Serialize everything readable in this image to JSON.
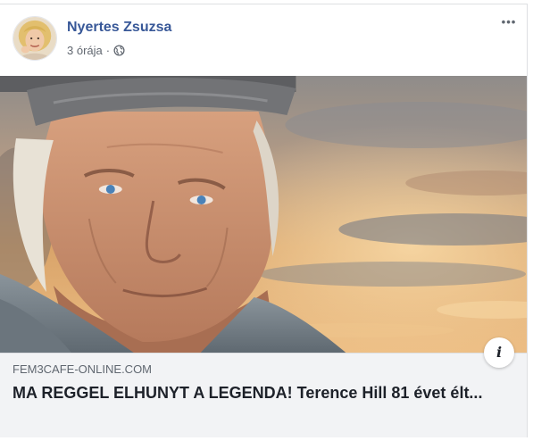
{
  "post": {
    "author": "Nyertes Zsuzsa",
    "timestamp": "3 órája",
    "separator": "·",
    "privacy_icon": "globe-icon",
    "more_icon": "more-options-icon",
    "more_glyph": "•••",
    "avatar_icon": "profile-avatar"
  },
  "link_preview": {
    "domain": "FEM3CAFE-ONLINE.COM",
    "title": "MA REGGEL ELHUNYT A LEGENDA! Terence Hill 81 évet élt...",
    "info_icon": "info-icon",
    "info_glyph": "i"
  },
  "colors": {
    "author_link": "#385898",
    "meta_text": "#616770",
    "preview_bg": "#f2f3f5",
    "title_text": "#1d2129",
    "border": "#dddfe2"
  }
}
